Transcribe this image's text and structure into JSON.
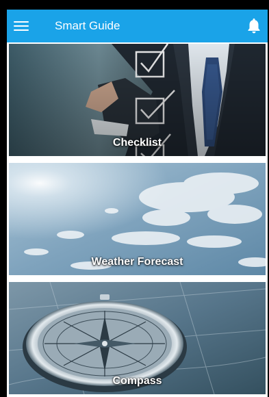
{
  "app_bar": {
    "title": "Smart Guide",
    "menu_icon": "menu-icon",
    "notification_icon": "bell-icon",
    "color": "#1aa3e8"
  },
  "cards": [
    {
      "label": "Checklist",
      "image": "businessman-checklist-photo"
    },
    {
      "label": "Weather Forecast",
      "image": "sky-clouds-photo"
    },
    {
      "label": "Compass",
      "image": "compass-on-map-photo"
    }
  ]
}
